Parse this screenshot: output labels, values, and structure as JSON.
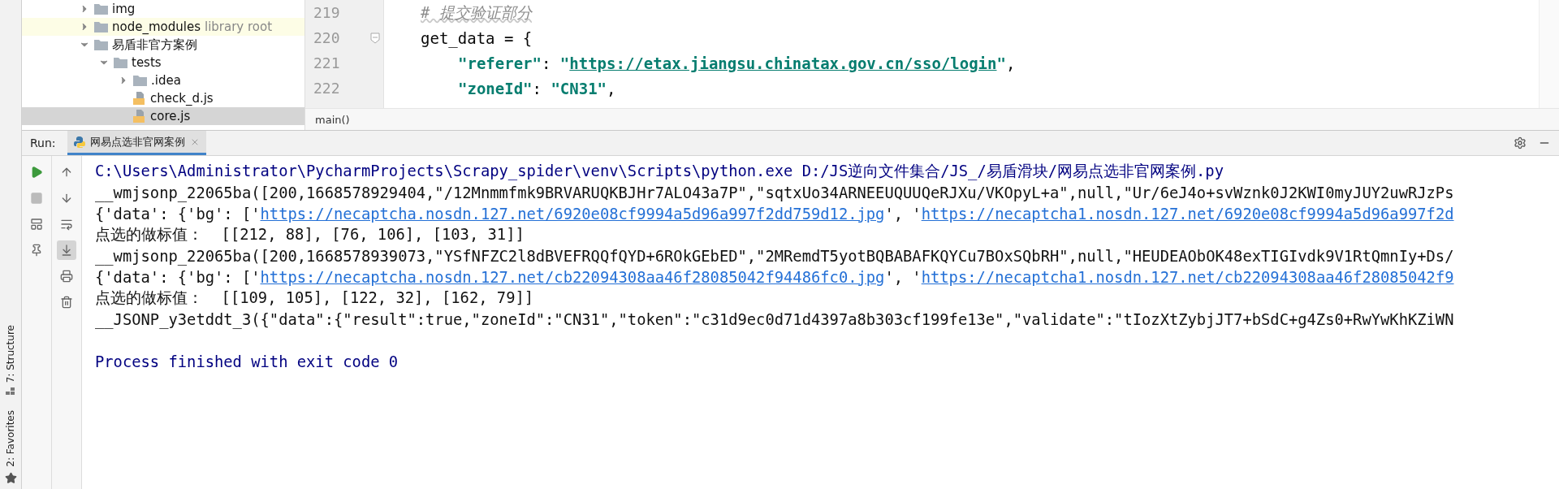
{
  "project_tree": [
    {
      "label": "img",
      "kind": "folder",
      "expanded": false,
      "selected": false,
      "highlighted": false
    },
    {
      "label": "node_modules",
      "note": "library root",
      "kind": "folder",
      "expanded": false,
      "selected": false,
      "highlighted": true
    },
    {
      "label": "易盾非官方案例",
      "kind": "folder",
      "expanded": true,
      "selected": false,
      "highlighted": false,
      "children": [
        {
          "label": "tests",
          "kind": "folder",
          "expanded": true,
          "selected": false,
          "highlighted": false,
          "children": [
            {
              "label": ".idea",
              "kind": "folder",
              "expanded": false,
              "selected": false,
              "highlighted": false
            },
            {
              "label": "check_d.js",
              "kind": "js",
              "selected": false,
              "highlighted": false
            },
            {
              "label": "core.js",
              "kind": "js",
              "selected": true,
              "highlighted": false
            }
          ]
        }
      ]
    }
  ],
  "editor": {
    "lines": [
      {
        "number": "219",
        "fold": false,
        "indented": false,
        "tokens": [
          {
            "kind": "comment",
            "text": "# 提交验证部分"
          }
        ]
      },
      {
        "number": "220",
        "fold": true,
        "indented": false,
        "tokens": [
          {
            "kind": "plain",
            "text": "get_data = {"
          }
        ]
      },
      {
        "number": "221",
        "fold": false,
        "indented": true,
        "tokens": [
          {
            "kind": "string",
            "text": "\"referer\""
          },
          {
            "kind": "plain",
            "text": ": "
          },
          {
            "kind": "string",
            "text": "\""
          },
          {
            "kind": "link",
            "text": "https://etax.jiangsu.chinatax.gov.cn/sso/login"
          },
          {
            "kind": "string",
            "text": "\""
          },
          {
            "kind": "plain",
            "text": ","
          }
        ]
      },
      {
        "number": "222",
        "fold": false,
        "indented": true,
        "tokens": [
          {
            "kind": "string",
            "text": "\"zoneId\""
          },
          {
            "kind": "plain",
            "text": ": "
          },
          {
            "kind": "string",
            "text": "\"CN31\""
          },
          {
            "kind": "plain",
            "text": ","
          }
        ]
      }
    ],
    "breadcrumb": "main()"
  },
  "sidebar_tabs": [
    {
      "label": "7: Structure",
      "kind": "structure"
    },
    {
      "label": "2: Favorites",
      "kind": "favorites"
    }
  ],
  "run_panel": {
    "label": "Run:",
    "tabs": [
      {
        "label": "网易点选非官网案例",
        "selected": true
      }
    ],
    "left_tools": [
      {
        "kind": "run",
        "disabled": false
      },
      {
        "kind": "stop",
        "disabled": true
      },
      {
        "kind": "layout",
        "disabled": false
      },
      {
        "kind": "pin",
        "disabled": false
      }
    ],
    "console_tools": [
      {
        "kind": "up",
        "on": false
      },
      {
        "kind": "down",
        "on": false
      },
      {
        "kind": "wrap",
        "on": false
      },
      {
        "kind": "scroll-end",
        "on": true
      },
      {
        "kind": "print",
        "on": false
      },
      {
        "kind": "trash",
        "on": false
      }
    ],
    "console": [
      {
        "kind": "cmd",
        "segments": [
          {
            "text": "C:\\Users\\Administrator\\PycharmProjects\\Scrapy_spider\\venv\\Scripts\\python.exe D:/JS逆向文件集合/JS_/易盾滑块/网易点选非官网案例.py",
            "link": false
          }
        ]
      },
      {
        "kind": "out",
        "segments": [
          {
            "text": "__wmjsonp_22065ba([200,1668578929404,\"/12Mnmmfmk9BRVARUQKBJHr7ALO43a7P\",\"sqtxUo34ARNEEUQUUQeRJXu/VKOpyL+a\",null,\"Ur/6eJ4o+svWznk0J2KWI0myJUY2uwRJzPs",
            "link": false
          }
        ]
      },
      {
        "kind": "out",
        "segments": [
          {
            "text": "{'data': {'bg': ['",
            "link": false
          },
          {
            "text": "https://necaptcha.nosdn.127.net/6920e08cf9994a5d96a997f2dd759d12.jpg",
            "link": true
          },
          {
            "text": "', '",
            "link": false
          },
          {
            "text": "https://necaptcha1.nosdn.127.net/6920e08cf9994a5d96a997f2d",
            "link": true
          }
        ]
      },
      {
        "kind": "out",
        "segments": [
          {
            "text": "点选的做标值：  [[212, 88], [76, 106], [103, 31]]",
            "link": false
          }
        ]
      },
      {
        "kind": "out",
        "segments": [
          {
            "text": "__wmjsonp_22065ba([200,1668578939073,\"YSfNFZC2l8dBVEFRQQfQYD+6ROkGEbED\",\"2MRemdT5yotBQBABAFKQYCu7BOxSQbRH\",null,\"HEUDEAObOK48exTIGIvdk9V1RtQmnIy+Ds/",
            "link": false
          }
        ]
      },
      {
        "kind": "out",
        "segments": [
          {
            "text": "{'data': {'bg': ['",
            "link": false
          },
          {
            "text": "https://necaptcha.nosdn.127.net/cb22094308aa46f28085042f94486fc0.jpg",
            "link": true
          },
          {
            "text": "', '",
            "link": false
          },
          {
            "text": "https://necaptcha1.nosdn.127.net/cb22094308aa46f28085042f9",
            "link": true
          }
        ]
      },
      {
        "kind": "out",
        "segments": [
          {
            "text": "点选的做标值：  [[109, 105], [122, 32], [162, 79]]",
            "link": false
          }
        ]
      },
      {
        "kind": "out",
        "segments": [
          {
            "text": "__JSONP_y3etddt_3({\"data\":{\"result\":true,\"zoneId\":\"CN31\",\"token\":\"c31d9ec0d71d4397a8b303cf199fe13e\",\"validate\":\"tIozXtZybjJT7+bSdC+g4Zs0+RwYwKhKZiWN",
            "link": false
          }
        ]
      },
      {
        "kind": "exit",
        "segments": [
          {
            "text": "Process finished with exit code 0",
            "link": false
          }
        ]
      }
    ]
  }
}
